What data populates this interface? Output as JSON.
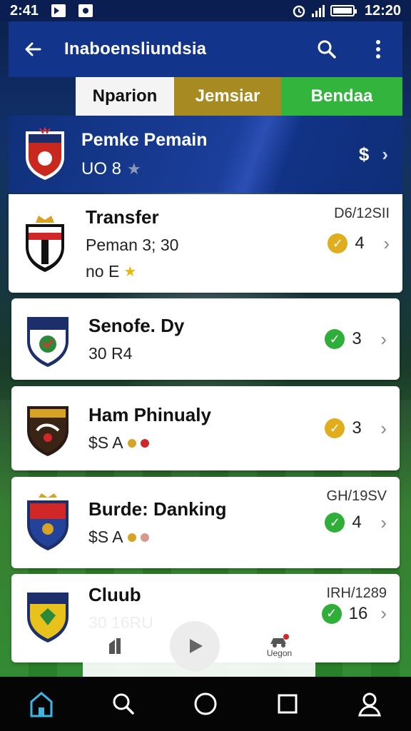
{
  "status_bar": {
    "time": "2:41",
    "clock": "12:20"
  },
  "app_bar": {
    "title": "Inaboensliundsia"
  },
  "tabs": [
    {
      "label": "Nparion",
      "color": "#f4f4f4"
    },
    {
      "label": "Jemsiar",
      "color": "#a88a22"
    },
    {
      "label": "Bendaa",
      "color": "#33b43c"
    }
  ],
  "featured": {
    "name": "Pemke Pemain",
    "score": "UO 8",
    "right": "$"
  },
  "items": [
    {
      "name": "Transfer",
      "date": "D6/12SII",
      "sub": "Peman 3; 30",
      "extra": "no E",
      "status": "gold",
      "count": "4"
    },
    {
      "name": "Senofe. Dy",
      "date": "",
      "sub": "30 R4",
      "extra": "",
      "status": "green",
      "count": "3"
    },
    {
      "name": "Ham Phinualy",
      "date": "",
      "sub": "$S A",
      "extra": "",
      "status": "gold",
      "count": "3"
    },
    {
      "name": "Burde: Danking",
      "date": "GH/19SV",
      "sub": "$S A",
      "extra": "",
      "status": "green",
      "count": "4"
    },
    {
      "name": "Cluub",
      "date": "IRH/1289",
      "sub": "30 16RU",
      "extra": "",
      "status": "green",
      "count": "16"
    }
  ],
  "mini_player": {
    "label": "Uegon"
  },
  "colors": {
    "appbar": "#12348a",
    "check_gold": "#e0ad1c",
    "check_green": "#2fae3a"
  }
}
